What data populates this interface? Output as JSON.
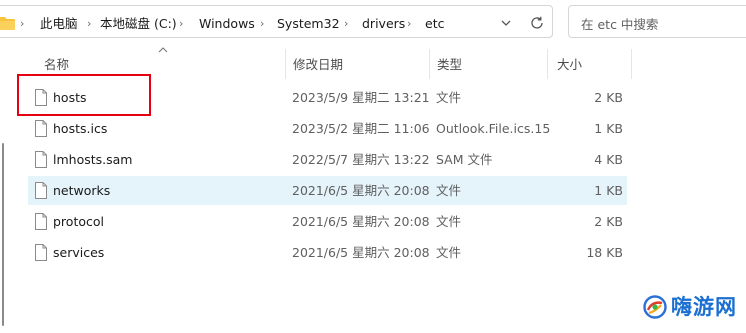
{
  "breadcrumb": [
    "此电脑",
    "本地磁盘 (C:)",
    "Windows",
    "System32",
    "drivers",
    "etc"
  ],
  "search": {
    "placeholder": "在 etc 中搜索"
  },
  "columns": {
    "name": "名称",
    "date": "修改日期",
    "type": "类型",
    "size": "大小"
  },
  "files": [
    {
      "name": "hosts",
      "date": "2023/5/9 星期二 13:21",
      "type": "文件",
      "size": "2 KB",
      "selected": false,
      "highlighted": true
    },
    {
      "name": "hosts.ics",
      "date": "2023/5/2 星期二 11:06",
      "type": "Outlook.File.ics.15",
      "size": "1 KB",
      "selected": false
    },
    {
      "name": "lmhosts.sam",
      "date": "2022/5/7 星期六 13:22",
      "type": "SAM 文件",
      "size": "4 KB",
      "selected": false
    },
    {
      "name": "networks",
      "date": "2021/6/5 星期六 20:08",
      "type": "文件",
      "size": "1 KB",
      "selected": true
    },
    {
      "name": "protocol",
      "date": "2021/6/5 星期六 20:08",
      "type": "文件",
      "size": "2 KB",
      "selected": false
    },
    {
      "name": "services",
      "date": "2021/6/5 星期六 20:08",
      "type": "文件",
      "size": "18 KB",
      "selected": false
    }
  ],
  "colors": {
    "highlight_box": "#e60012",
    "selected_row": "#e5f3fb",
    "watermark": "#1b6fd1"
  },
  "watermark": {
    "text": "嗨游网"
  }
}
